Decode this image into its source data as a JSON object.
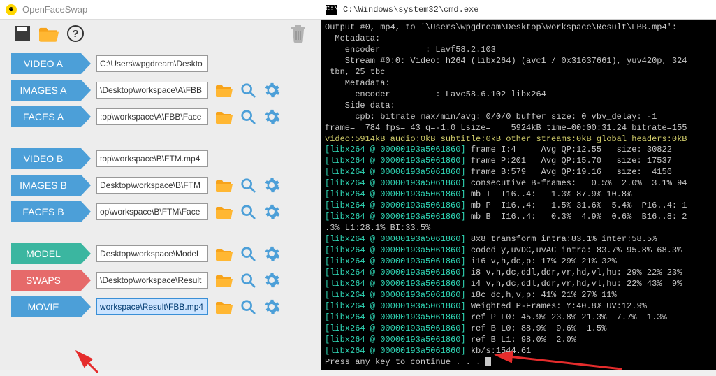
{
  "left": {
    "app_title": "OpenFaceSwap",
    "rows": [
      {
        "label": "VIDEO A",
        "color": "blue",
        "value": "C:\\Users\\wpgdream\\Deskto",
        "icons": false
      },
      {
        "label": "IMAGES A",
        "color": "blue",
        "value": "\\Desktop\\workspace\\A\\FBB",
        "icons": true
      },
      {
        "label": "FACES A",
        "color": "blue",
        "value": ":op\\workspace\\A\\FBB\\Face",
        "icons": true
      },
      {
        "gap": true
      },
      {
        "label": "VIDEO B",
        "color": "blue",
        "value": "top\\workspace\\B\\FTM.mp4",
        "icons": false
      },
      {
        "label": "IMAGES B",
        "color": "blue",
        "value": "Desktop\\workspace\\B\\FTM",
        "icons": true
      },
      {
        "label": "FACES B",
        "color": "blue",
        "value": "op\\workspace\\B\\FTM\\Face",
        "icons": true
      },
      {
        "gap": true
      },
      {
        "label": "MODEL",
        "color": "teal",
        "value": "Desktop\\workspace\\Model",
        "icons": true
      },
      {
        "label": "SWAPS",
        "color": "red",
        "value": "\\Desktop\\workspace\\Result",
        "icons": true
      },
      {
        "label": "MOVIE",
        "color": "blue",
        "value": "workspace\\Result\\FBB.mp4",
        "icons": true,
        "selected": true
      }
    ]
  },
  "right": {
    "title": "C:\\Windows\\system32\\cmd.exe",
    "lines": [
      {
        "t": "Output #0, mp4, to '\\Users\\wpgdream\\Desktop\\workspace\\Result\\FBB.mp4':"
      },
      {
        "t": "  Metadata:"
      },
      {
        "t": "    encoder         : Lavf58.2.103"
      },
      {
        "t": "    Stream #0:0: Video: h264 (libx264) (avc1 / 0x31637661), yuv420p, 324"
      },
      {
        "t": " tbn, 25 tbc"
      },
      {
        "t": "    Metadata:"
      },
      {
        "t": "      encoder         : Lavc58.6.102 libx264"
      },
      {
        "t": "    Side data:"
      },
      {
        "t": "      cpb: bitrate max/min/avg: 0/0/0 buffer size: 0 vbv_delay: -1"
      },
      {
        "t": "frame=  784 fps= 43 q=-1.0 Lsize=    5924kB time=00:00:31.24 bitrate=155"
      },
      {
        "t": "video:5914kB audio:0kB subtitle:0kB other streams:0kB global headers:0kB",
        "c": "yellow"
      },
      {
        "pre": "[libx264 @ 00000193a5061860]",
        "t": " frame I:4     Avg QP:12.55   size: 30822"
      },
      {
        "pre": "[libx264 @ 00000193a5061860]",
        "t": " frame P:201   Avg QP:15.70   size: 17537"
      },
      {
        "pre": "[libx264 @ 00000193a5061860]",
        "t": " frame B:579   Avg QP:19.16   size:  4156"
      },
      {
        "pre": "[libx264 @ 00000193a5061860]",
        "t": " consecutive B-frames:   0.5%  2.0%  3.1% 94"
      },
      {
        "pre": "[libx264 @ 00000193a5061860]",
        "t": " mb I  I16..4:   1.3% 87.9% 10.8%"
      },
      {
        "pre": "[libx264 @ 00000193a5061860]",
        "t": " mb P  I16..4:   1.5% 31.6%  5.4%  P16..4: 1"
      },
      {
        "pre": "[libx264 @ 00000193a5061860]",
        "t": " mb B  I16..4:   0.3%  4.9%  0.6%  B16..8: 2"
      },
      {
        "t": ".3% L1:28.1% BI:33.5%"
      },
      {
        "pre": "[libx264 @ 00000193a5061860]",
        "t": " 8x8 transform intra:83.1% inter:58.5%"
      },
      {
        "pre": "[libx264 @ 00000193a5061860]",
        "t": " coded y,uvDC,uvAC intra: 83.7% 95.8% 68.3%"
      },
      {
        "pre": "[libx264 @ 00000193a5061860]",
        "t": " i16 v,h,dc,p: 17% 29% 21% 32%"
      },
      {
        "pre": "[libx264 @ 00000193a5061860]",
        "t": " i8 v,h,dc,ddl,ddr,vr,hd,vl,hu: 29% 22% 23%"
      },
      {
        "pre": "[libx264 @ 00000193a5061860]",
        "t": " i4 v,h,dc,ddl,ddr,vr,hd,vl,hu: 22% 43%  9%"
      },
      {
        "pre": "[libx264 @ 00000193a5061860]",
        "t": " i8c dc,h,v,p: 41% 21% 27% 11%"
      },
      {
        "pre": "[libx264 @ 00000193a5061860]",
        "t": " Weighted P-Frames: Y:40.8% UV:12.9%"
      },
      {
        "pre": "[libx264 @ 00000193a5061860]",
        "t": " ref P L0: 45.9% 23.8% 21.3%  7.7%  1.3%"
      },
      {
        "pre": "[libx264 @ 00000193a5061860]",
        "t": " ref B L0: 88.9%  9.6%  1.5%"
      },
      {
        "pre": "[libx264 @ 00000193a5061860]",
        "t": " ref B L1: 98.0%  2.0%"
      },
      {
        "pre": "[libx264 @ 00000193a5061860]",
        "t": " kb/s:1544.61"
      },
      {
        "t": "Press any key to continue . . . ",
        "cursor": true
      }
    ]
  }
}
